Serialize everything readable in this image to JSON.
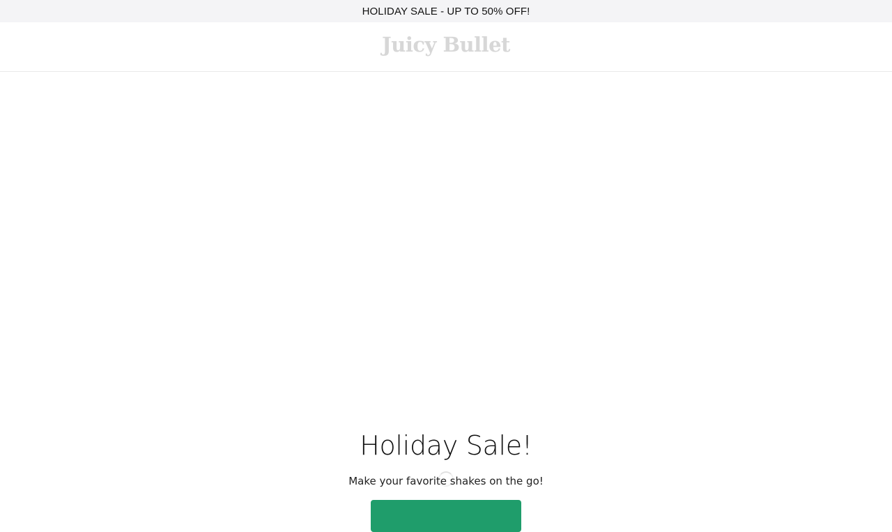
{
  "announcement": {
    "text": "HOLIDAY SALE - UP TO 50% OFF!"
  },
  "header": {
    "logo_text": "Juicy Bullet"
  },
  "hero": {
    "title": "Holiday Sale!",
    "subtitle": "Make your favorite shakes on the go!",
    "button_label": ""
  },
  "colors": {
    "announcement_bg": "#f4f4f6",
    "logo": "#d7d7d7",
    "button_accent": "#1f9d6b"
  }
}
